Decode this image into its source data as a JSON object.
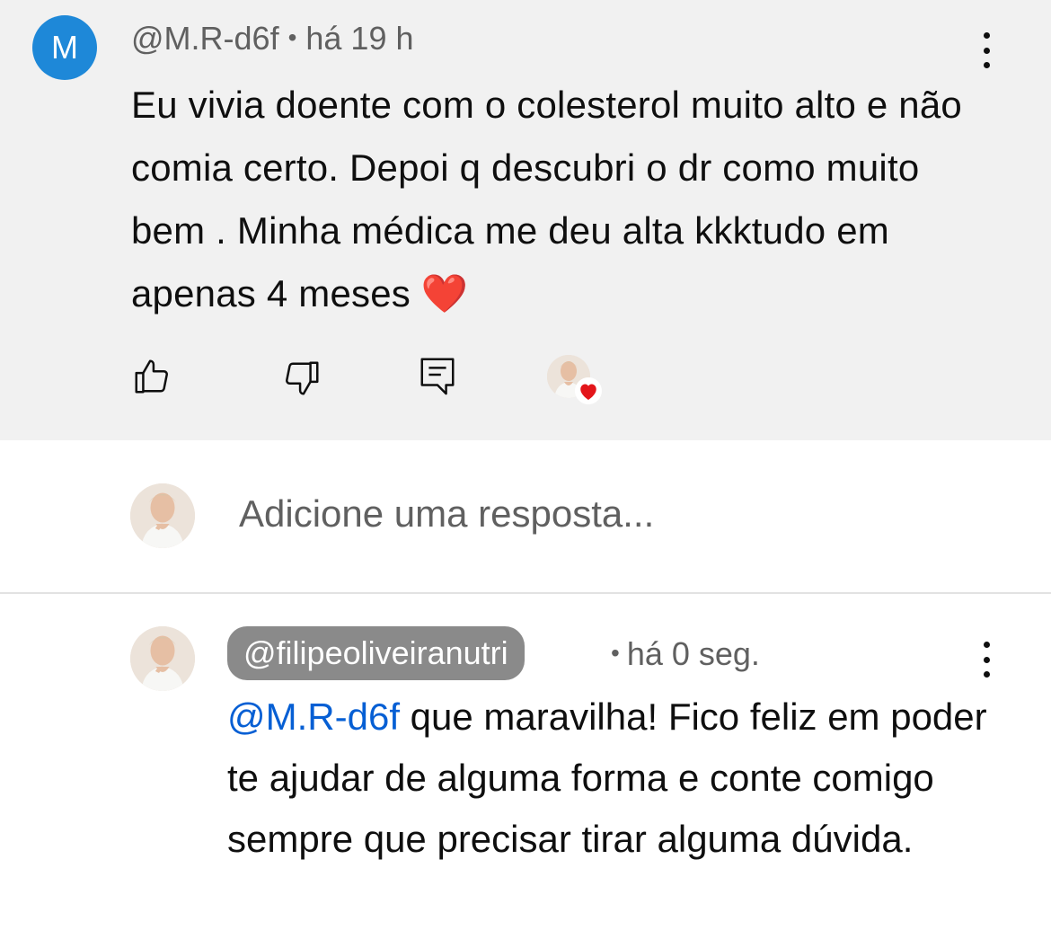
{
  "comment": {
    "avatar_letter": "M",
    "author": "@M.R-d6f",
    "separator": "•",
    "time": "há 19 h",
    "text": "Eu vivia doente  com o colesterol muito alto e não comia certo. Depoi q descubri o dr como  muito bem . Minha médica me deu alta kkktudo em apenas 4 meses",
    "emoji": "❤️",
    "actions": [
      "like-icon",
      "dislike-icon",
      "reply-icon",
      "creator-heart-icon"
    ],
    "menu_icon": "more-vert-icon"
  },
  "reply_box": {
    "placeholder": "Adicione uma resposta..."
  },
  "reply": {
    "author": "@filipeoliveiranutri",
    "separator": "•",
    "time": "há 0 seg.",
    "mention": "@M.R-d6f",
    "text": " que maravilha! Fico feliz em poder te ajudar de alguma forma e conte comigo sempre que precisar tirar alguma dúvida.",
    "menu_icon": "more-vert-icon"
  },
  "colors": {
    "comment_bg": "#f1f1f1",
    "avatar_blue": "#1e88d8",
    "mention_blue": "#065fd4",
    "chip_gray": "#8a8a8a",
    "heart_red": "#e3151a"
  }
}
